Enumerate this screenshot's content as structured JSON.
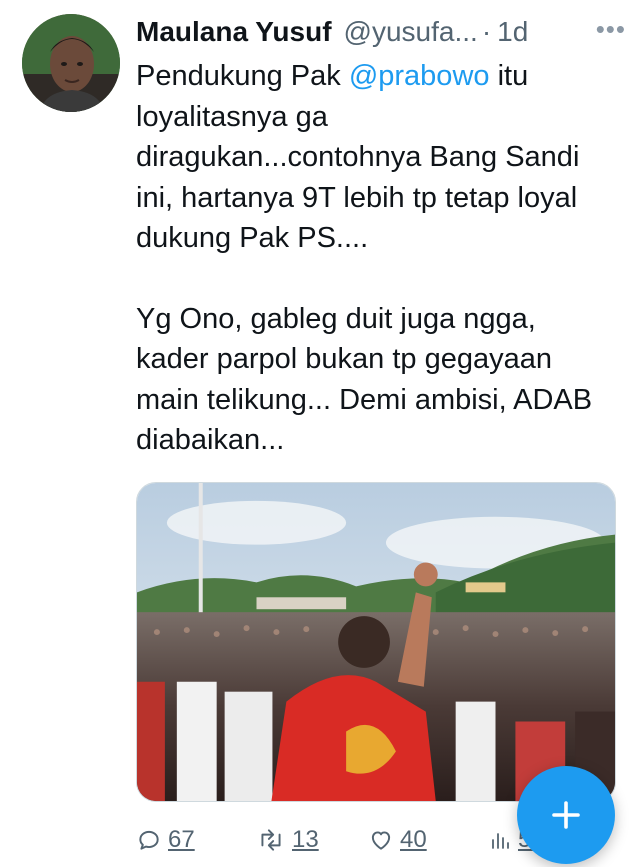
{
  "tweet": {
    "display_name": "Maulana Yusuf",
    "handle": "@yusufa...",
    "dot": "·",
    "time": "1d",
    "more": "•••",
    "text_line1_pre": "Pendukung Pak ",
    "mention": "@prabowo",
    "text_line1_post": " itu loyalitasnya ga diragukan...contohnya Bang Sandi ini, hartanya 9T lebih tp tetap loyal dukung Pak PS....",
    "paragraph2": "Yg Ono, gableg duit juga ngga, kader parpol bukan tp gegayaan main telikung... Demi ambisi, ADAB diabaikan..."
  },
  "actions": {
    "replies": "67",
    "retweets": "13",
    "likes": "40",
    "views": "5.6"
  },
  "icons": {
    "avatar": "profile-photo",
    "reply": "speech-bubble-icon",
    "retweet": "retweet-arrows-icon",
    "like": "heart-icon",
    "views": "bar-chart-icon",
    "fab": "plus-icon"
  },
  "colors": {
    "link": "#1d9bf0",
    "secondary": "#536471",
    "fab": "#1d9bf0"
  }
}
